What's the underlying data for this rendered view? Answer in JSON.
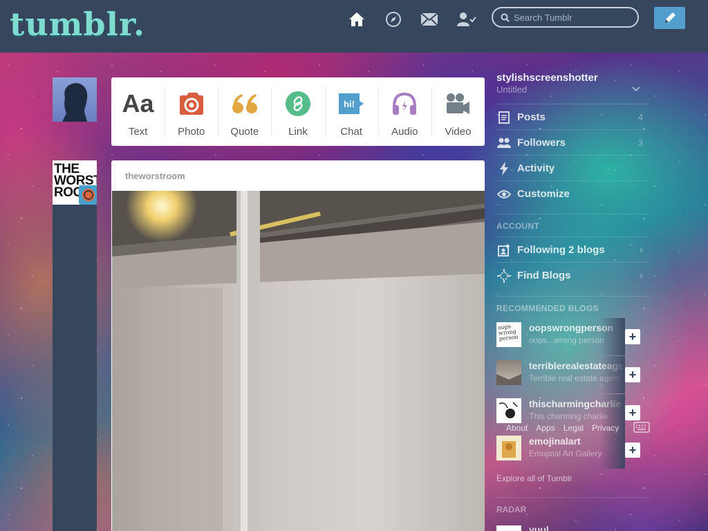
{
  "header": {
    "logo": "tumblr.",
    "nav": [
      "home-icon",
      "explore-icon",
      "inbox-icon",
      "account-icon"
    ],
    "search": {
      "placeholder": "Search Tumblr",
      "value": ""
    },
    "compose_icon": "pencil-icon"
  },
  "colors": {
    "header_bg": "#36465d",
    "photo_accent": "#d95e40",
    "quote_accent": "#e2a741",
    "link_accent": "#56bc8a",
    "chat_accent": "#529ecc",
    "audio_accent": "#a77dc2",
    "video_accent": "#748089"
  },
  "post_types": [
    {
      "label": "Text",
      "icon": "text-icon"
    },
    {
      "label": "Photo",
      "icon": "camera-icon"
    },
    {
      "label": "Quote",
      "icon": "quote-icon"
    },
    {
      "label": "Link",
      "icon": "link-icon"
    },
    {
      "label": "Chat",
      "icon": "chat-icon",
      "glyph": "hi!"
    },
    {
      "label": "Audio",
      "icon": "headphones-icon"
    },
    {
      "label": "Video",
      "icon": "video-camera-icon"
    }
  ],
  "blog_avatar_text": "THE WORST ROO",
  "post": {
    "blog_name": "theworstroom"
  },
  "sidebar": {
    "blog_name": "stylishscreenshotter",
    "blog_title": "Untitled",
    "items": [
      {
        "label": "Posts",
        "icon": "posts-icon",
        "count": "4"
      },
      {
        "label": "Followers",
        "icon": "followers-icon",
        "count": "3"
      },
      {
        "label": "Activity",
        "icon": "activity-icon"
      },
      {
        "label": "Customize",
        "icon": "eye-icon"
      }
    ],
    "account_title": "ACCOUNT",
    "account_items": [
      {
        "label": "Following 2 blogs",
        "icon": "following-icon"
      },
      {
        "label": "Find Blogs",
        "icon": "find-blogs-icon"
      }
    ],
    "recommended_title": "RECOMMENDED BLOGS",
    "recommended": [
      {
        "name": "oopswrongperson",
        "desc": "oops...wrong person",
        "thumb_text": "oops wrong person"
      },
      {
        "name": "terriblerealestateagent",
        "desc": "Terrible real estate agent",
        "thumb_text": ""
      },
      {
        "name": "thischarmingcharlie",
        "desc": "This charming charlie",
        "thumb_text": ""
      },
      {
        "name": "emojinalart",
        "desc": "Emojinal Art Gallery",
        "thumb_text": ""
      }
    ],
    "footer_links": [
      "About",
      "Apps",
      "Legal",
      "Privacy"
    ],
    "explore": "Explore all of Tumblr",
    "radar_title": "RADAR",
    "radar_name": "yuul"
  }
}
